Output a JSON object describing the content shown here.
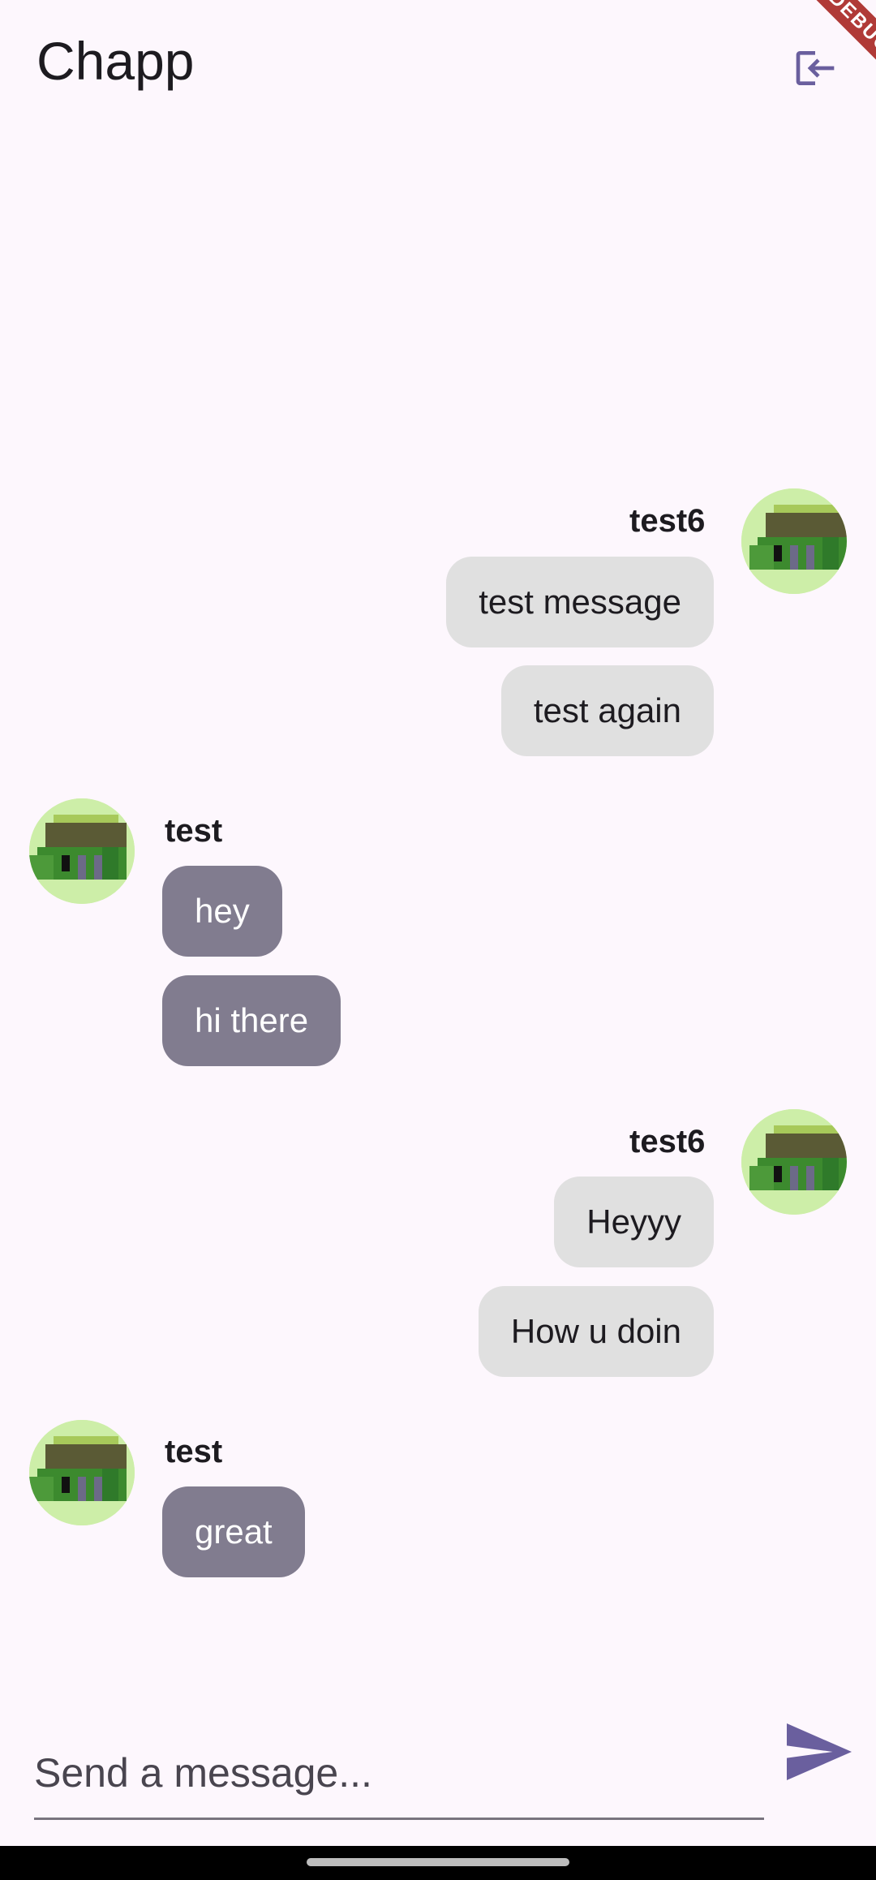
{
  "app": {
    "title": "Chapp",
    "debug_banner": "DEBUG"
  },
  "messages": [
    {
      "sender": "test6",
      "side": "mine",
      "bubbles": [
        "test message",
        "test again"
      ]
    },
    {
      "sender": "test",
      "side": "theirs",
      "bubbles": [
        "hey",
        "hi there"
      ]
    },
    {
      "sender": "test6",
      "side": "mine",
      "bubbles": [
        "Heyyy",
        "How u doin"
      ]
    },
    {
      "sender": "test",
      "side": "theirs",
      "bubbles": [
        "great"
      ]
    }
  ],
  "composer": {
    "placeholder": "Send a message..."
  },
  "icons": {
    "logout": "logout-icon",
    "send": "send-icon",
    "avatar": "pixel-avatar"
  },
  "colors": {
    "background": "#fdf7fd",
    "accent": "#6a5f9e",
    "mine_bubble": "#e0e0e0",
    "theirs_bubble": "#817c8f"
  }
}
